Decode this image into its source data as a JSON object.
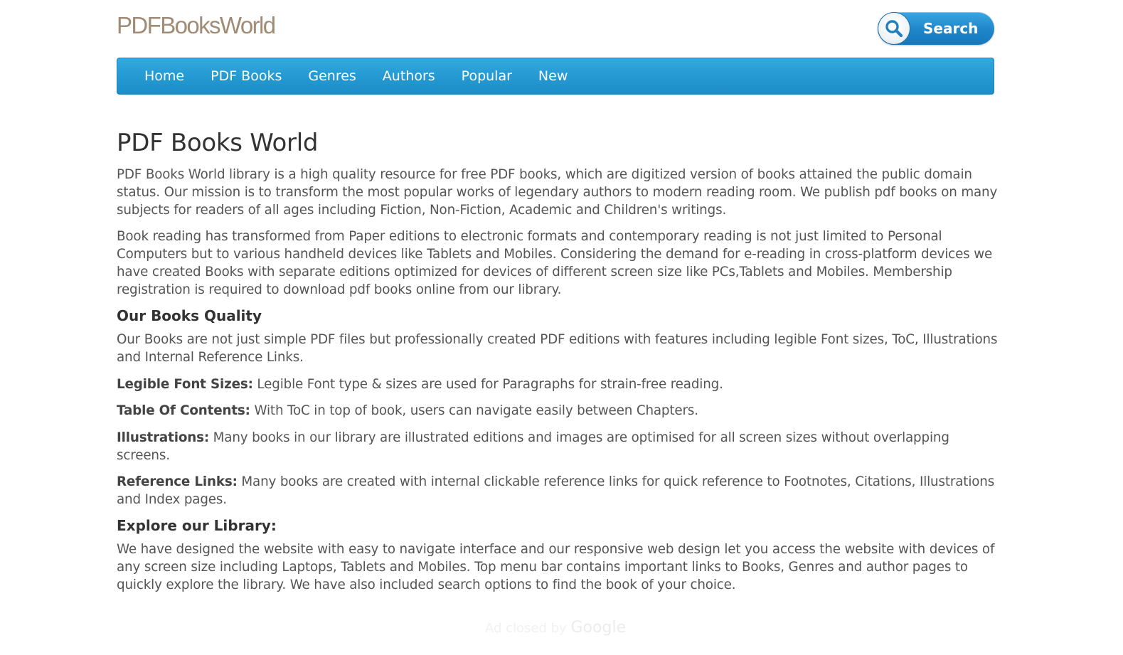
{
  "header": {
    "logo_text": "PDFBooksWorld",
    "search_label": "Search"
  },
  "nav": {
    "items": [
      "Home",
      "PDF Books",
      "Genres",
      "Authors",
      "Popular",
      "New"
    ]
  },
  "main": {
    "title": "PDF Books World",
    "intro_paragraphs": [
      "PDF Books World library is a high quality resource for free PDF books, which are digitized version of books attained the public domain status. Our mission is to transform the most popular works of legendary authors to modern reading room. We publish pdf books on many subjects for readers of all ages including Fiction, Non-Fiction, Academic and Children's writings.",
      "Book reading has transformed from Paper editions to electronic formats and contemporary reading is not just limited to Personal Computers but to various handheld devices like Tablets and Mobiles. Considering the demand for e-reading in cross-platform devices we have created Books with separate editions optimized for devices of different screen size like PCs,Tablets and Mobiles. Membership registration is required to download pdf books online from our library."
    ],
    "quality_heading": "Our Books Quality",
    "quality_intro": "Our Books are not just simple PDF files but professionally created PDF editions with features including legible Font sizes, ToC, Illustrations and Internal Reference Links.",
    "features": [
      {
        "label": "Legible Font Sizes:",
        "text": " Legible Font type & sizes are used for Paragraphs for strain-free reading."
      },
      {
        "label": "Table Of Contents:",
        "text": " With ToC in top of book, users can navigate easily between Chapters."
      },
      {
        "label": "Illustrations:",
        "text": " Many books in our library are illustrated editions and images are optimised for all screen sizes without overlapping screens."
      },
      {
        "label": "Reference Links:",
        "text": "  Many books are created with internal clickable reference links for quick reference to  Footnotes, Citations, Illustrations and Index pages."
      }
    ],
    "explore_heading": "Explore our Library:",
    "explore_text": "We have designed the website with easy to navigate interface  and our responsive web design let you access the website with devices of any screen size including Laptops, Tablets and Mobiles. Top menu bar contains important links to Books, Genres and author pages to quickly explore the library. We have also included search options to find the book of your choice."
  },
  "ad_notice": {
    "text": "Ad closed by ",
    "brand": "Google"
  },
  "colors": {
    "nav_blue": "#259ad3",
    "logo_tan": "#a08c74",
    "text_gray": "#555555"
  }
}
